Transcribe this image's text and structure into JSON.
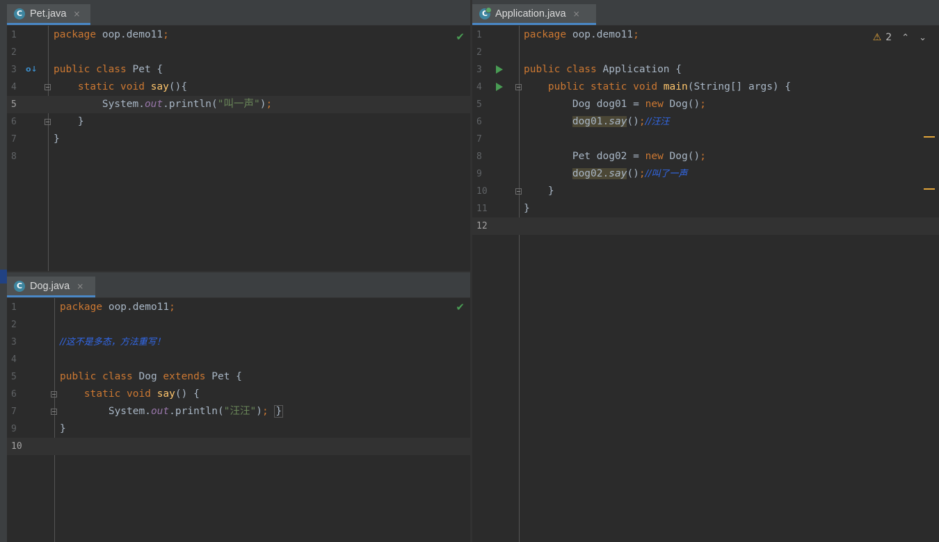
{
  "panes": {
    "pet": {
      "tab_label": "Pet.java",
      "tab_icon": "C",
      "status": "no-problems",
      "lines": [
        {
          "n": "1",
          "html": "<span class=\"kw\">package</span> oop.demo11<span class=\"kw\">;</span>"
        },
        {
          "n": "2",
          "html": ""
        },
        {
          "n": "3",
          "html": "<span class=\"kw\">public class</span> Pet {"
        },
        {
          "n": "4",
          "html": "    <span class=\"kw\">static void</span> <span class=\"fn\">say</span>(){"
        },
        {
          "n": "5",
          "html": "        System.<span class=\"fld\">out</span>.println(<span class=\"st\">\"叫一声\"</span>)<span class=\"kw\">;</span>"
        },
        {
          "n": "6",
          "html": "    }"
        },
        {
          "n": "7",
          "html": "}"
        },
        {
          "n": "8",
          "html": ""
        }
      ],
      "current_line": "5"
    },
    "dog": {
      "tab_label": "Dog.java",
      "tab_icon": "C",
      "status": "no-problems",
      "lines": [
        {
          "n": "1",
          "html": "<span class=\"kw\">package</span> oop.demo11<span class=\"kw\">;</span>"
        },
        {
          "n": "2",
          "html": ""
        },
        {
          "n": "3",
          "html": "<span class=\"cm\">//这不是多态，方法重写！</span>"
        },
        {
          "n": "4",
          "html": ""
        },
        {
          "n": "5",
          "html": "<span class=\"kw\">public class</span> Dog <span class=\"kw\">extends</span> Pet {"
        },
        {
          "n": "6",
          "html": "    <span class=\"kw\">static void</span> <span class=\"fn\">say</span>() {"
        },
        {
          "n": "7",
          "html": "        System.<span class=\"fld\">out</span>.println(<span class=\"st\">\"汪汪\"</span>)<span class=\"kw\">;</span> <span class=\"brace-box\">}</span>"
        },
        {
          "n": "9",
          "html": "}"
        },
        {
          "n": "10",
          "html": ""
        }
      ],
      "current_line": "10"
    },
    "app": {
      "tab_label": "Application.java",
      "tab_icon": "C",
      "warning_count": "2",
      "lines": [
        {
          "n": "1",
          "html": "<span class=\"kw\">package</span> oop.demo11<span class=\"kw\">;</span>"
        },
        {
          "n": "2",
          "html": ""
        },
        {
          "n": "3",
          "html": "<span class=\"kw\">public class</span> Application {"
        },
        {
          "n": "4",
          "html": "    <span class=\"kw\">public static void</span> <span class=\"fn\">main</span>(String[] args) {"
        },
        {
          "n": "5",
          "html": "        Dog dog01 = <span class=\"kw\">new</span> Dog()<span class=\"kw\">;</span>"
        },
        {
          "n": "6",
          "html": "        <span class=\"hl\">dog01.<span class=\"ital\">say</span></span>()<span class=\"kw\">;</span><span class=\"cm\">//汪汪</span>"
        },
        {
          "n": "7",
          "html": ""
        },
        {
          "n": "8",
          "html": "        Pet dog02 = <span class=\"kw\">new</span> Dog()<span class=\"kw\">;</span>"
        },
        {
          "n": "9",
          "html": "        <span class=\"hl\">dog02.<span class=\"ital\">say</span></span>()<span class=\"kw\">;</span><span class=\"cm\">//叫了一声</span>"
        },
        {
          "n": "10",
          "html": "    }"
        },
        {
          "n": "11",
          "html": "}"
        },
        {
          "n": "12",
          "html": ""
        }
      ],
      "current_line": "12"
    }
  },
  "icons": {
    "close": "×",
    "check": "✔",
    "warning": "⚠",
    "prev": "⌃",
    "next": "⌄"
  },
  "colors": {
    "keyword": "#cc7832",
    "string": "#6a8759",
    "method_decl": "#ffc66d",
    "static_field": "#9876aa",
    "comment": "#3268e8",
    "usage_highlight": "#4b4735"
  }
}
